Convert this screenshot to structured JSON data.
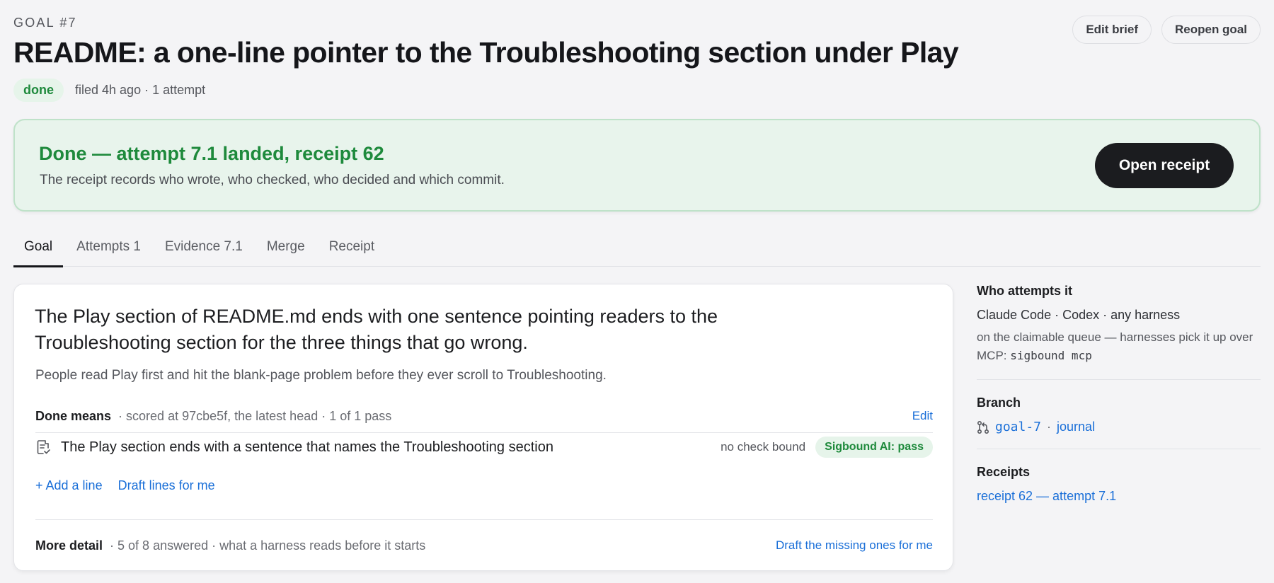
{
  "header": {
    "goal_id": "GOAL #7",
    "title": "README: a one-line pointer to the Troubleshooting section under Play",
    "status": "done",
    "meta": "filed 4h ago · 1 attempt",
    "actions": {
      "edit_brief": "Edit brief",
      "reopen_goal": "Reopen goal"
    }
  },
  "banner": {
    "title": "Done — attempt 7.1 landed, receipt 62",
    "text": "The receipt records who wrote, who checked, who decided and which commit.",
    "button": "Open receipt"
  },
  "tabs": [
    {
      "label": "Goal",
      "active": true
    },
    {
      "label": "Attempts 1"
    },
    {
      "label": "Evidence 7.1"
    },
    {
      "label": "Merge"
    },
    {
      "label": "Receipt"
    }
  ],
  "goal_card": {
    "lead": "The Play section of README.md ends with one sentence pointing readers to the Troubleshooting section for the three things that go wrong.",
    "sub": "People read Play first and hit the blank-page problem before they ever scroll to Troubleshooting.",
    "done_means": {
      "label": "Done means",
      "meta": "· scored at 97cbe5f, the latest head · 1 of 1 pass",
      "edit": "Edit",
      "criteria": [
        {
          "text": "The Play section ends with a sentence that names the Troubleshooting section",
          "note": "no check bound",
          "badge": "Sigbound AI: pass",
          "icon": "checklist-icon"
        }
      ],
      "add_line": "+ Add a line",
      "draft_lines": "Draft lines for me"
    },
    "more_detail": {
      "label": "More detail",
      "meta": "· 5 of 8 answered · what a harness reads before it starts",
      "action": "Draft the missing ones for me"
    }
  },
  "sidebar": {
    "who": {
      "heading": "Who attempts it",
      "line": "Claude Code · Codex · any harness",
      "note": "on the claimable queue — harnesses pick it up over MCP:",
      "command": "sigbound mcp"
    },
    "branch": {
      "heading": "Branch",
      "name": "goal-7",
      "separator": "·",
      "link": "journal",
      "icon": "git-branch-icon"
    },
    "receipts": {
      "heading": "Receipts",
      "link": "receipt 62 — attempt 7.1"
    }
  },
  "colors": {
    "accent_green": "#1e8a3c",
    "link_blue": "#1a6fd8",
    "banner_bg": "#e8f4ec",
    "dark_button": "#1b1c1f"
  }
}
